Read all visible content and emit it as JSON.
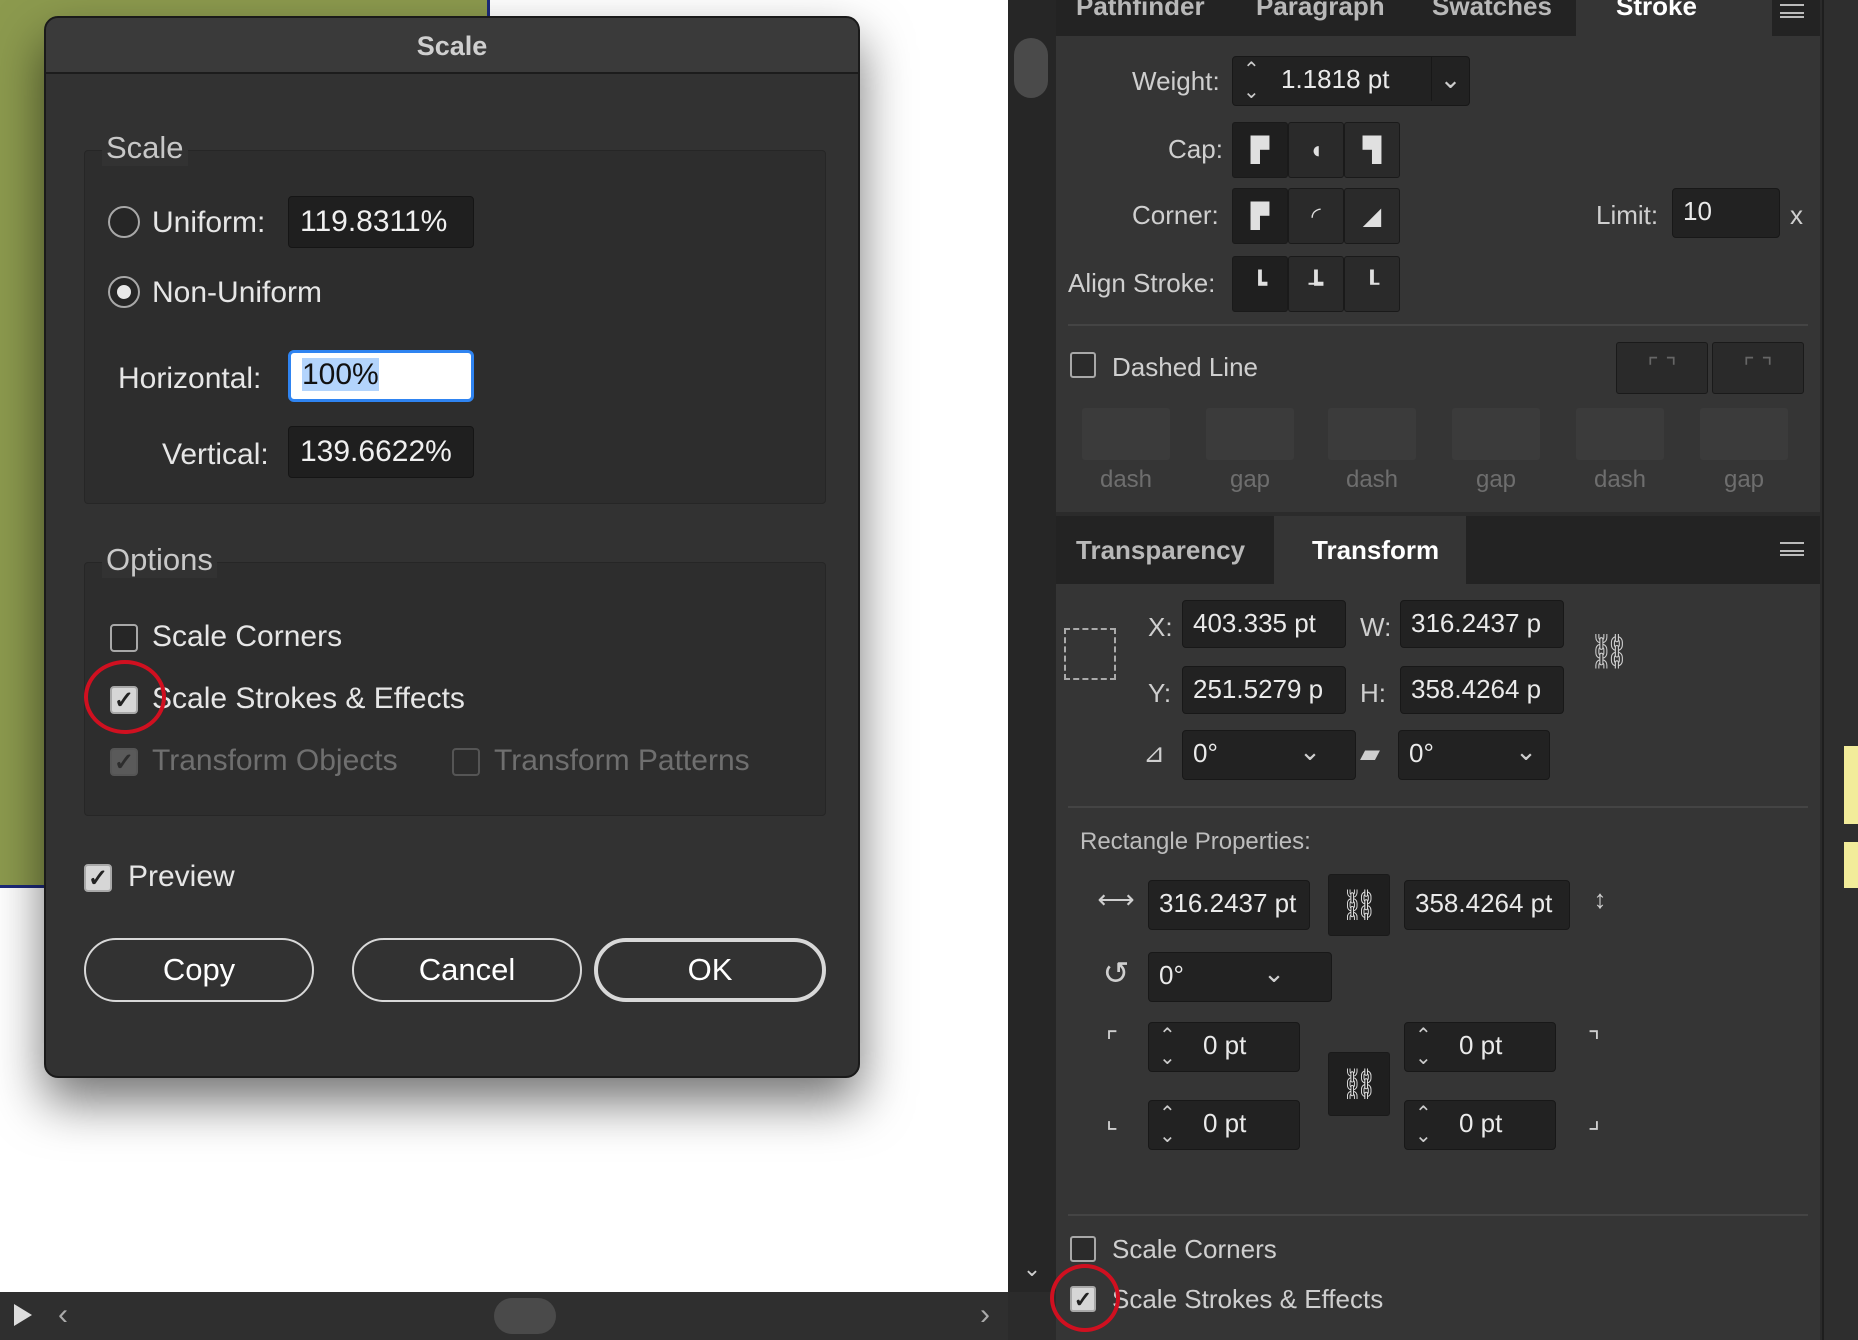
{
  "dialog": {
    "title": "Scale",
    "scale_group": "Scale",
    "uniform_label": "Uniform:",
    "uniform_value": "119.8311%",
    "non_uniform_label": "Non-Uniform",
    "horizontal_label": "Horizontal:",
    "horizontal_value": "100%",
    "vertical_label": "Vertical:",
    "vertical_value": "139.6622%",
    "options_group": "Options",
    "scale_corners": "Scale Corners",
    "scale_strokes": "Scale Strokes & Effects",
    "transform_objects": "Transform Objects",
    "transform_patterns": "Transform Patterns",
    "preview": "Preview",
    "copy": "Copy",
    "cancel": "Cancel",
    "ok": "OK",
    "check": "✓"
  },
  "stroke_panel": {
    "tabs": [
      "Pathfinder",
      "Paragraph",
      "Swatches",
      "Stroke"
    ],
    "weight_label": "Weight:",
    "weight_value": "1.1818 pt",
    "cap_label": "Cap:",
    "corner_label": "Corner:",
    "limit_label": "Limit:",
    "limit_value": "10",
    "limit_unit": "x",
    "align_label": "Align Stroke:",
    "dashed_line": "Dashed Line",
    "dash_labels": [
      "dash",
      "gap",
      "dash",
      "gap",
      "dash",
      "gap"
    ]
  },
  "transform_panel": {
    "tabs": [
      "Transparency",
      "Transform"
    ],
    "x_label": "X:",
    "x_value": "403.335 pt",
    "y_label": "Y:",
    "y_value": "251.5279 p",
    "w_label": "W:",
    "w_value": "316.2437 p",
    "h_label": "H:",
    "h_value": "358.4264 p",
    "rotate_value": "0°",
    "shear_value": "0°",
    "rect_props": "Rectangle Properties:",
    "rect_w": "316.2437 pt",
    "rect_h": "358.4264 pt",
    "rect_rotate": "0°",
    "corner_tl": "0 pt",
    "corner_tr": "0 pt",
    "corner_bl": "0 pt",
    "corner_br": "0 pt",
    "scale_corners": "Scale Corners",
    "scale_strokes": "Scale Strokes & Effects"
  },
  "colors": {
    "annotation": "#d01020",
    "focus": "#2f84f1",
    "artwork": "#8c9a4e"
  }
}
